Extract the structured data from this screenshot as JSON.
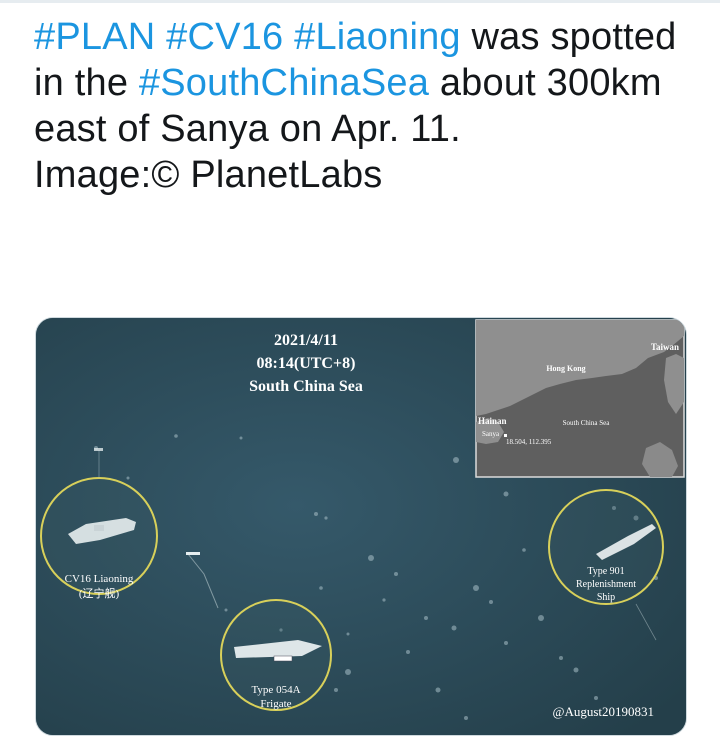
{
  "tweet": {
    "segments": [
      {
        "text": "#PLAN",
        "kind": "hashtag"
      },
      {
        "text": " ",
        "kind": "text"
      },
      {
        "text": "#CV16",
        "kind": "hashtag"
      },
      {
        "text": " ",
        "kind": "text"
      },
      {
        "text": "#Liaoning",
        "kind": "hashtag"
      },
      {
        "text": " was spotted in the ",
        "kind": "text"
      },
      {
        "text": "#SouthChinaSea",
        "kind": "hashtag"
      },
      {
        "text": " about 300km east of Sanya on Apr. 11.",
        "kind": "text"
      }
    ],
    "credit": "Image:© PlanetLabs"
  },
  "image": {
    "date": "2021/4/11",
    "time": "08:14(UTC+8)",
    "region": "South China Sea",
    "inset_map": {
      "taiwan": "Taiwan",
      "hong_kong": "Hong Kong",
      "hainan": "Hainan",
      "sanya": "Sanya",
      "sea": "South China Sea",
      "coords": "18.504, 112.395"
    },
    "callouts": {
      "liaoning": {
        "line1": "CV16 Liaoning",
        "line2": "(辽宁舰)"
      },
      "frigate": {
        "line1": "Type 054A",
        "line2": "Frigate"
      },
      "replenishment": {
        "line1": "Type 901",
        "line2": "Replenishment",
        "line3": "Ship"
      }
    },
    "watermark": "@August20190831"
  },
  "colors": {
    "hashtag": "#1b95e0",
    "text": "#14171a",
    "sea": "#2f4f5c",
    "circle": "#d8d05a",
    "inset_land": "#8f8f8f",
    "inset_sea": "#5a5a5a"
  }
}
